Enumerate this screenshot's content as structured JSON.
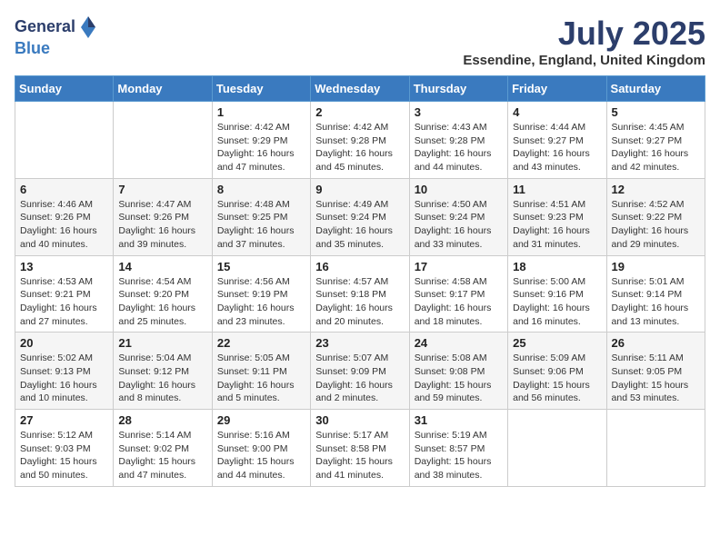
{
  "logo": {
    "general": "General",
    "blue": "Blue"
  },
  "title": "July 2025",
  "location": "Essendine, England, United Kingdom",
  "days_of_week": [
    "Sunday",
    "Monday",
    "Tuesday",
    "Wednesday",
    "Thursday",
    "Friday",
    "Saturday"
  ],
  "weeks": [
    [
      {
        "day": "",
        "info": ""
      },
      {
        "day": "",
        "info": ""
      },
      {
        "day": "1",
        "info": "Sunrise: 4:42 AM\nSunset: 9:29 PM\nDaylight: 16 hours and 47 minutes."
      },
      {
        "day": "2",
        "info": "Sunrise: 4:42 AM\nSunset: 9:28 PM\nDaylight: 16 hours and 45 minutes."
      },
      {
        "day": "3",
        "info": "Sunrise: 4:43 AM\nSunset: 9:28 PM\nDaylight: 16 hours and 44 minutes."
      },
      {
        "day": "4",
        "info": "Sunrise: 4:44 AM\nSunset: 9:27 PM\nDaylight: 16 hours and 43 minutes."
      },
      {
        "day": "5",
        "info": "Sunrise: 4:45 AM\nSunset: 9:27 PM\nDaylight: 16 hours and 42 minutes."
      }
    ],
    [
      {
        "day": "6",
        "info": "Sunrise: 4:46 AM\nSunset: 9:26 PM\nDaylight: 16 hours and 40 minutes."
      },
      {
        "day": "7",
        "info": "Sunrise: 4:47 AM\nSunset: 9:26 PM\nDaylight: 16 hours and 39 minutes."
      },
      {
        "day": "8",
        "info": "Sunrise: 4:48 AM\nSunset: 9:25 PM\nDaylight: 16 hours and 37 minutes."
      },
      {
        "day": "9",
        "info": "Sunrise: 4:49 AM\nSunset: 9:24 PM\nDaylight: 16 hours and 35 minutes."
      },
      {
        "day": "10",
        "info": "Sunrise: 4:50 AM\nSunset: 9:24 PM\nDaylight: 16 hours and 33 minutes."
      },
      {
        "day": "11",
        "info": "Sunrise: 4:51 AM\nSunset: 9:23 PM\nDaylight: 16 hours and 31 minutes."
      },
      {
        "day": "12",
        "info": "Sunrise: 4:52 AM\nSunset: 9:22 PM\nDaylight: 16 hours and 29 minutes."
      }
    ],
    [
      {
        "day": "13",
        "info": "Sunrise: 4:53 AM\nSunset: 9:21 PM\nDaylight: 16 hours and 27 minutes."
      },
      {
        "day": "14",
        "info": "Sunrise: 4:54 AM\nSunset: 9:20 PM\nDaylight: 16 hours and 25 minutes."
      },
      {
        "day": "15",
        "info": "Sunrise: 4:56 AM\nSunset: 9:19 PM\nDaylight: 16 hours and 23 minutes."
      },
      {
        "day": "16",
        "info": "Sunrise: 4:57 AM\nSunset: 9:18 PM\nDaylight: 16 hours and 20 minutes."
      },
      {
        "day": "17",
        "info": "Sunrise: 4:58 AM\nSunset: 9:17 PM\nDaylight: 16 hours and 18 minutes."
      },
      {
        "day": "18",
        "info": "Sunrise: 5:00 AM\nSunset: 9:16 PM\nDaylight: 16 hours and 16 minutes."
      },
      {
        "day": "19",
        "info": "Sunrise: 5:01 AM\nSunset: 9:14 PM\nDaylight: 16 hours and 13 minutes."
      }
    ],
    [
      {
        "day": "20",
        "info": "Sunrise: 5:02 AM\nSunset: 9:13 PM\nDaylight: 16 hours and 10 minutes."
      },
      {
        "day": "21",
        "info": "Sunrise: 5:04 AM\nSunset: 9:12 PM\nDaylight: 16 hours and 8 minutes."
      },
      {
        "day": "22",
        "info": "Sunrise: 5:05 AM\nSunset: 9:11 PM\nDaylight: 16 hours and 5 minutes."
      },
      {
        "day": "23",
        "info": "Sunrise: 5:07 AM\nSunset: 9:09 PM\nDaylight: 16 hours and 2 minutes."
      },
      {
        "day": "24",
        "info": "Sunrise: 5:08 AM\nSunset: 9:08 PM\nDaylight: 15 hours and 59 minutes."
      },
      {
        "day": "25",
        "info": "Sunrise: 5:09 AM\nSunset: 9:06 PM\nDaylight: 15 hours and 56 minutes."
      },
      {
        "day": "26",
        "info": "Sunrise: 5:11 AM\nSunset: 9:05 PM\nDaylight: 15 hours and 53 minutes."
      }
    ],
    [
      {
        "day": "27",
        "info": "Sunrise: 5:12 AM\nSunset: 9:03 PM\nDaylight: 15 hours and 50 minutes."
      },
      {
        "day": "28",
        "info": "Sunrise: 5:14 AM\nSunset: 9:02 PM\nDaylight: 15 hours and 47 minutes."
      },
      {
        "day": "29",
        "info": "Sunrise: 5:16 AM\nSunset: 9:00 PM\nDaylight: 15 hours and 44 minutes."
      },
      {
        "day": "30",
        "info": "Sunrise: 5:17 AM\nSunset: 8:58 PM\nDaylight: 15 hours and 41 minutes."
      },
      {
        "day": "31",
        "info": "Sunrise: 5:19 AM\nSunset: 8:57 PM\nDaylight: 15 hours and 38 minutes."
      },
      {
        "day": "",
        "info": ""
      },
      {
        "day": "",
        "info": ""
      }
    ]
  ]
}
